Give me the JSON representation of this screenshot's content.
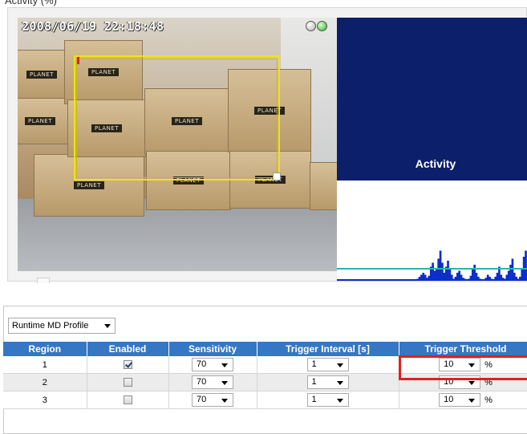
{
  "top_partial_text": "Activity (%)",
  "viewer": {
    "timestamp": "2008/06/19 22:18:48",
    "box_label": "PLANET",
    "activity_title": "Activity",
    "colors": {
      "panel_bg": "#0b1f6a",
      "graph_fill": "#0b2fc8",
      "threshold_line": "#2ab5b0",
      "region_border": "#f0e21a"
    },
    "activity_levels": [
      0,
      0,
      0,
      0,
      0,
      0,
      0,
      0,
      0,
      0,
      0,
      0,
      0,
      0,
      0,
      0,
      0,
      0,
      0,
      0,
      0,
      0,
      0,
      0,
      0,
      0,
      0,
      0,
      0,
      0,
      0,
      0,
      0,
      0,
      0,
      0,
      0,
      0,
      0,
      0,
      0,
      0,
      2,
      4,
      6,
      8,
      6,
      3,
      5,
      14,
      18,
      10,
      12,
      22,
      30,
      18,
      8,
      14,
      20,
      12,
      6,
      2,
      4,
      8,
      10,
      6,
      3,
      2,
      0,
      2,
      5,
      12,
      16,
      8,
      4,
      2,
      0,
      0,
      3,
      6,
      4,
      2,
      0,
      4,
      8,
      14,
      6,
      3,
      2,
      6,
      10,
      16,
      22,
      8,
      4,
      2,
      4,
      12,
      24,
      30,
      14,
      8,
      4,
      2
    ],
    "threshold_level": 12
  },
  "md_settings": {
    "profile_select": "Runtime MD Profile",
    "columns": [
      "Region",
      "Enabled",
      "Sensitivity",
      "Trigger Interval [s]",
      "Trigger Threshold"
    ],
    "threshold_unit": "%",
    "rows": [
      {
        "region": "1",
        "enabled": true,
        "sensitivity": "70",
        "interval": "1",
        "threshold": "10"
      },
      {
        "region": "2",
        "enabled": false,
        "sensitivity": "70",
        "interval": "1",
        "threshold": "10"
      },
      {
        "region": "3",
        "enabled": false,
        "sensitivity": "70",
        "interval": "1",
        "threshold": "10"
      }
    ]
  }
}
